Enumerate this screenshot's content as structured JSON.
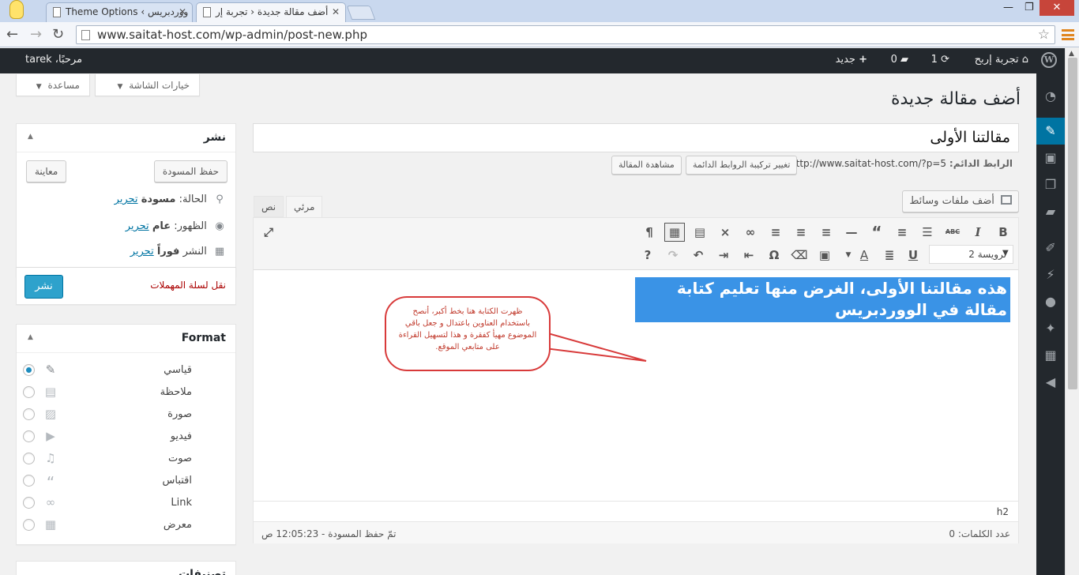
{
  "browser": {
    "tabs": [
      {
        "title": "Theme Options ‹ ووردبريس"
      },
      {
        "title": "أضف مقالة جديدة ‹ تجربة إر"
      }
    ],
    "url": "www.saitat-host.com/wp-admin/post-new.php"
  },
  "adminbar": {
    "site_name": "تجربة إربح",
    "updates_count": "1",
    "comments_count": "0",
    "new_label": "جديد",
    "greeting": "مرحبًا، tarek"
  },
  "screen": {
    "options_label": "خيارات الشاشة",
    "help_label": "مساعدة"
  },
  "page": {
    "title": "أضف مقالة جديدة"
  },
  "post": {
    "title_value": "مقالتنا الأولى",
    "permalink_label": "الرابط الدائم:",
    "permalink_url": "http://www.saitat-host.com/?p=5",
    "change_permalinks_label": "تغيير تركيبة الروابط الدائمة",
    "view_post_label": "مشاهدة المقالة"
  },
  "editor": {
    "add_media_label": "أضف ملفات وسائط",
    "tab_visual": "مرئي",
    "tab_text": "نص",
    "format_select_value": "ترويسة 2",
    "content_heading": "هذه مقالتنا الأولى، الغرض منها تعليم كتابة مقالة في الووردبريس",
    "path": "h2",
    "word_count": "عدد الكلمات: 0",
    "draft_saved": "تمّ حفظ المسودة - 12:05:23 ص"
  },
  "callout": {
    "text": "ظهرت الكتابة هنا بخط أكبر، أنصح باستخدام العناوين باعتدال و جعل باقي الموضوع مهيأ كفقرة و هذا لتسهيل القراءة على متابعي الموقع."
  },
  "publish_box": {
    "title": "نشر",
    "save_draft_label": "حفظ المسودة",
    "preview_label": "معاينة",
    "status_label": "الحالة:",
    "status_value": "مسودة",
    "visibility_label": "الظهور:",
    "visibility_value": "عام",
    "publish_time_label": "النشر",
    "publish_time_value": "فوراً",
    "edit_label": "تحرير",
    "trash_label": "نقل لسلة المهملات",
    "publish_label": "نشر"
  },
  "format_box": {
    "title": "Format",
    "options": [
      {
        "label": "قياسي",
        "icon": "pin-icon",
        "selected": true
      },
      {
        "label": "ملاحظة",
        "icon": "aside-icon",
        "selected": false
      },
      {
        "label": "صورة",
        "icon": "image-icon",
        "selected": false
      },
      {
        "label": "فيديو",
        "icon": "video-icon",
        "selected": false
      },
      {
        "label": "صوت",
        "icon": "audio-icon",
        "selected": false
      },
      {
        "label": "اقتباس",
        "icon": "quote-icon",
        "selected": false
      },
      {
        "label": "Link",
        "icon": "link-icon",
        "selected": false
      },
      {
        "label": "معرض",
        "icon": "gallery-icon",
        "selected": false
      }
    ]
  },
  "categories_box": {
    "title": "تصنيفات"
  },
  "colors": {
    "admin_bar": "#23282d",
    "accent": "#0074a2",
    "publish": "#2ea2cc",
    "selection": "#3a93e6",
    "callout": "#d83a3a"
  }
}
